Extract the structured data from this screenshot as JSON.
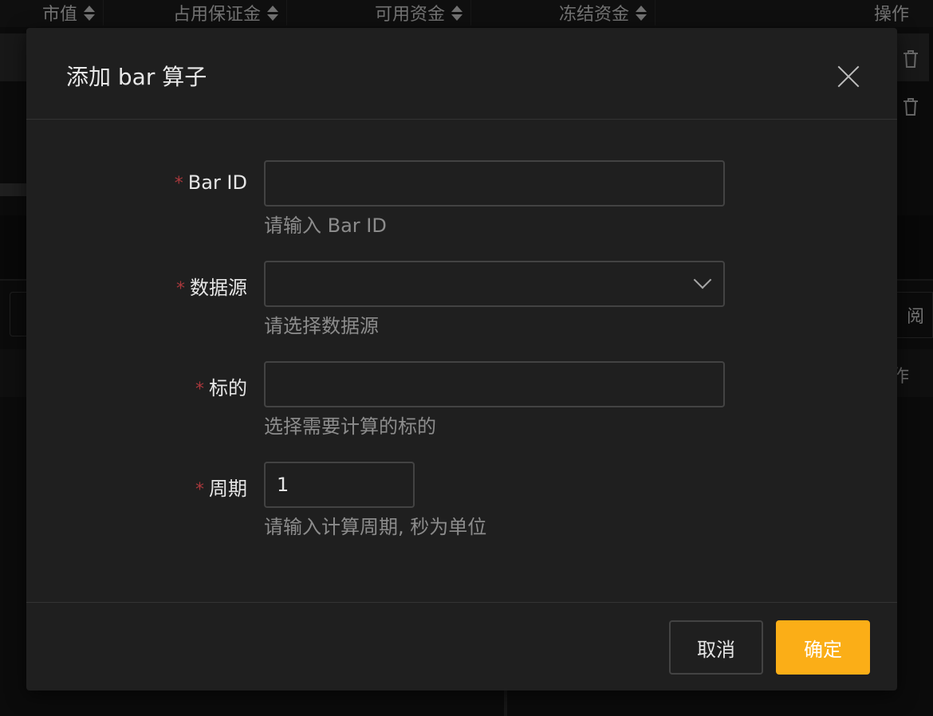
{
  "background": {
    "columns": [
      {
        "label": "市值"
      },
      {
        "label": "占用保证金"
      },
      {
        "label": "可用资金"
      },
      {
        "label": "冻结资金"
      },
      {
        "label": "操作"
      }
    ],
    "right_button_label": "阅",
    "table_head_label": "作"
  },
  "modal": {
    "title": "添加 bar 算子",
    "required_mark": "*",
    "fields": {
      "bar_id": {
        "label": "Bar ID",
        "value": "",
        "help": "请输入 Bar ID"
      },
      "source": {
        "label": "数据源",
        "value": "",
        "help": "请选择数据源"
      },
      "symbol": {
        "label": "标的",
        "value": "",
        "help": "选择需要计算的标的"
      },
      "period": {
        "label": "周期",
        "value": "1",
        "help": "请输入计算周期, 秒为单位"
      }
    },
    "footer": {
      "cancel_label": "取消",
      "ok_label": "确定"
    }
  },
  "colors": {
    "primary": "#fbae17",
    "required": "#a8383c",
    "modal_bg": "#1f1f1f"
  }
}
